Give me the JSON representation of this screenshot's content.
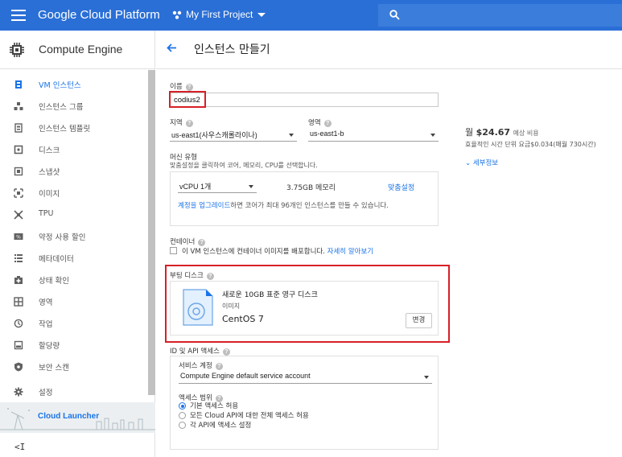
{
  "topbar": {
    "title": "Google Cloud Platform",
    "project": "My First Project",
    "bg_color": "#2a6fd6"
  },
  "sidebar": {
    "product": "Compute Engine",
    "items": [
      {
        "label": "VM 인스턴스",
        "icon": "vm-instances-icon",
        "active": true
      },
      {
        "label": "인스턴스 그룹",
        "icon": "instance-groups-icon"
      },
      {
        "label": "인스턴스 템플릿",
        "icon": "instance-templates-icon"
      },
      {
        "label": "디스크",
        "icon": "disk-icon"
      },
      {
        "label": "스냅샷",
        "icon": "snapshot-icon"
      },
      {
        "label": "이미지",
        "icon": "image-icon"
      },
      {
        "label": "TPU",
        "icon": "tpu-icon"
      },
      {
        "label": "약정 사용 할인",
        "icon": "committed-use-icon"
      },
      {
        "label": "메타데이터",
        "icon": "metadata-icon"
      },
      {
        "label": "상태 확인",
        "icon": "health-check-icon"
      },
      {
        "label": "영역",
        "icon": "zones-icon"
      },
      {
        "label": "작업",
        "icon": "operations-icon"
      },
      {
        "label": "할당량",
        "icon": "quotas-icon"
      },
      {
        "label": "보안 스캔",
        "icon": "security-scan-icon"
      },
      {
        "label": "설정",
        "icon": "settings-icon"
      }
    ],
    "launcher": "Cloud Launcher",
    "collapse": "<I"
  },
  "page": {
    "title": "인스턴스 만들기"
  },
  "form": {
    "name_label": "이름",
    "name_value": "codius2",
    "region_label": "지역",
    "region_value": "us-east1(사우스캐롤라이나)",
    "zone_label": "영역",
    "zone_value": "us-east1-b",
    "machine_label": "머신 유형",
    "machine_desc": "맞춤설정을 클릭하여 코어, 메모리, CPU를 선택합니다.",
    "vcpu_value": "vCPU 1개",
    "memory": "3.75GB 메모리",
    "customize": "맞춤설정",
    "upgrade_link": "계정을 업그레이드",
    "upgrade_rest": "하면 코어가 최대 96개인 인스턴스를 만들 수 있습니다.",
    "container_label": "컨테이너",
    "container_check": "이 VM 인스턴스에 컨테이너 이미지를 배포합니다.",
    "container_link": "자세히 알아보기",
    "boot_label": "부팅 디스크",
    "boot_title": "새로운 10GB 표준 영구 디스크",
    "boot_sub": "이미지",
    "boot_os": "CentOS 7",
    "change_btn": "변경",
    "id_api_label": "ID 및 API 액세스",
    "service_account_label": "서비스 계정",
    "service_account_value": "Compute Engine default service account",
    "access_scope_label": "액세스 범위",
    "scopes": [
      {
        "label": "기본 액세스 허용",
        "selected": true
      },
      {
        "label": "모든 Cloud API에 대한 전체 액세스 허용",
        "selected": false
      },
      {
        "label": "각 API에 액세스 설정",
        "selected": false
      }
    ]
  },
  "pricing": {
    "prefix": "월",
    "amount": "$24.67",
    "estimate": "예상 비용",
    "hourly": "효율적인 시간 단위 요금$0.034(매월 730시간)",
    "details": "세부정보"
  },
  "highlight_color": "#d62027"
}
